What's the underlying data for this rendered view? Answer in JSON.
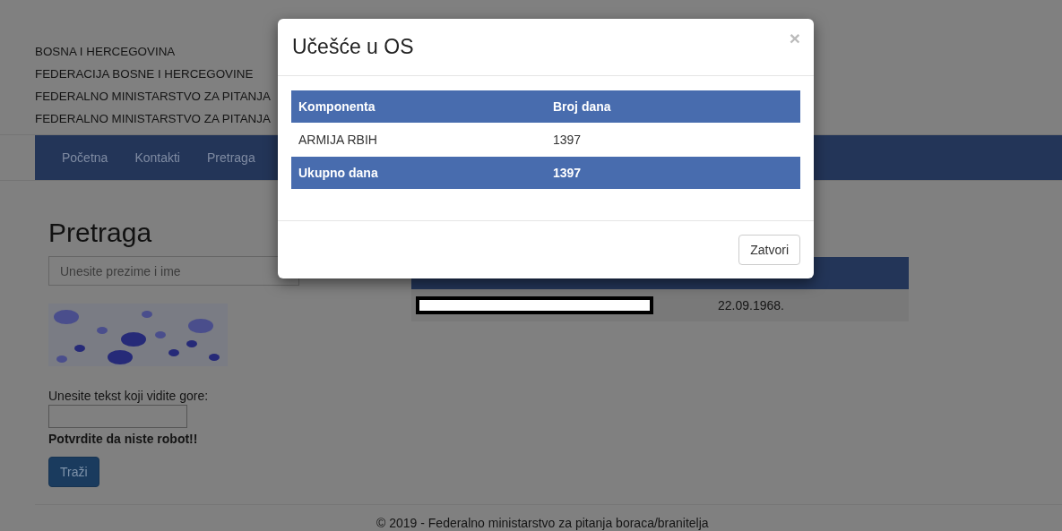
{
  "page": {
    "header_lines": [
      "BOSNA I HERCEGOVINA",
      "FEDERACIJA BOSNE I HERCEGOVINE",
      "FEDERALNO MINISTARSTVO ZA PITANJA",
      "FEDERALNO MINISTARSTVO ZA PITANJA"
    ],
    "nav": [
      {
        "label": "Početna"
      },
      {
        "label": "Kontakti"
      },
      {
        "label": "Pretraga"
      }
    ],
    "search": {
      "heading": "Pretraga",
      "name_field": {
        "placeholder": "Unesite prezime i ime"
      },
      "captcha_label": "Unesite tekst koji vidite gore:",
      "warning": "Potvrdite da niste robot!!",
      "submit": "Traži"
    },
    "results": {
      "rows": [
        {
          "name_redacted": true,
          "date": "22.09.1968."
        }
      ]
    },
    "footer": "© 2019 - Federalno ministarstvo za pitanja boraca/branitelja"
  },
  "modal": {
    "title": "Učešće u OS",
    "close": "×",
    "table": {
      "columns": [
        "Komponenta",
        "Broj dana"
      ],
      "rows": [
        {
          "kind": "data",
          "cells": [
            "ARMIJA RBIH",
            "1397"
          ]
        },
        {
          "kind": "total",
          "cells": [
            "Ukupno dana",
            "1397"
          ]
        }
      ]
    },
    "buttons": [
      "Zatvori"
    ]
  }
}
